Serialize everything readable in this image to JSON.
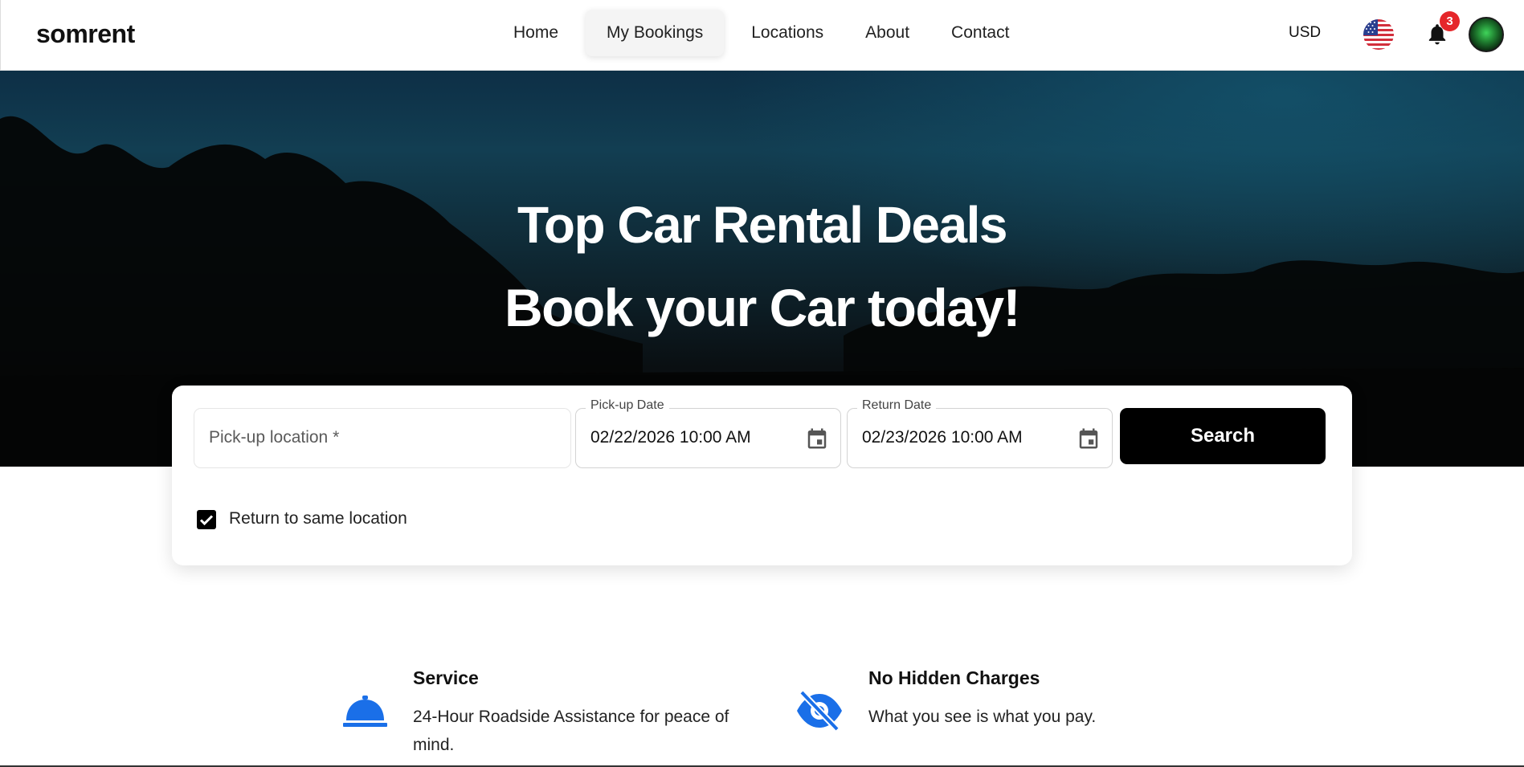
{
  "header": {
    "logo": "somrent",
    "nav": [
      "Home",
      "My Bookings",
      "Locations",
      "About",
      "Contact"
    ],
    "active_nav": "My Bookings",
    "currency": "USD",
    "notification_count": "3"
  },
  "hero": {
    "title_line1": "Top Car Rental Deals",
    "title_line2": "Book your Car today!"
  },
  "search": {
    "pickup_location_placeholder": "Pick-up location *",
    "pickup_date_label": "Pick-up Date",
    "pickup_date_value": "02/22/2026 10:00 AM",
    "return_date_label": "Return Date",
    "return_date_value": "02/23/2026 10:00 AM",
    "search_label": "Search",
    "return_same_location_label": "Return to same location",
    "return_same_location_checked": true
  },
  "features": [
    {
      "title": "Service",
      "text": "24-Hour Roadside Assistance for peace of mind.",
      "icon": "service-bell-icon"
    },
    {
      "title": "No Hidden Charges",
      "text": "What you see is what you pay.",
      "icon": "eye-slash-icon"
    }
  ],
  "colors": {
    "accent": "#1a6fe8",
    "badge": "#e5262a",
    "button": "#000000"
  }
}
